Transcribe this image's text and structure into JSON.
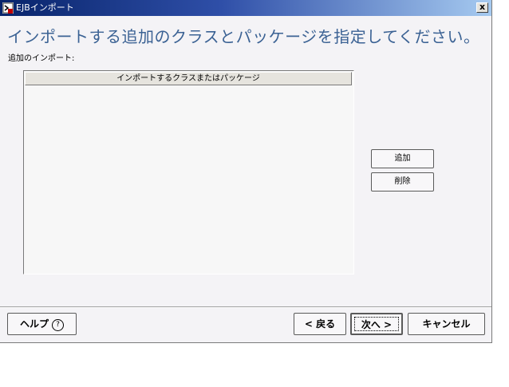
{
  "window": {
    "title": "EJBインポート",
    "close_label": "x"
  },
  "page": {
    "heading": "インポートする追加のクラスとパッケージを指定してください。",
    "imports_label": "追加のインポート:",
    "list_header": "インポートするクラスまたはパッケージ"
  },
  "side_buttons": {
    "add": "追加",
    "remove": "削除"
  },
  "footer": {
    "help": "ヘルプ",
    "help_icon": "?",
    "back": "< 戻る",
    "next": "次へ >",
    "cancel": "キャンセル"
  }
}
